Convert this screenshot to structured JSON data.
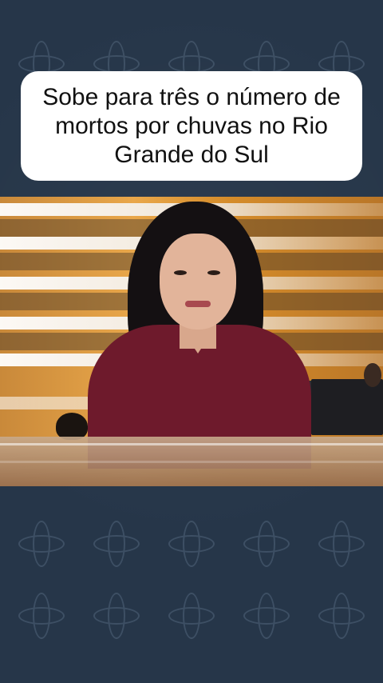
{
  "headline": {
    "text": "Sobe para três o número de mortos por chuvas no Rio Grande do Sul"
  },
  "video": {
    "description_icon": "news-anchor-video-frame",
    "colors": {
      "studio_orange": "#e9a74a",
      "blouse": "#6e1a2c",
      "background": "#263649"
    }
  }
}
